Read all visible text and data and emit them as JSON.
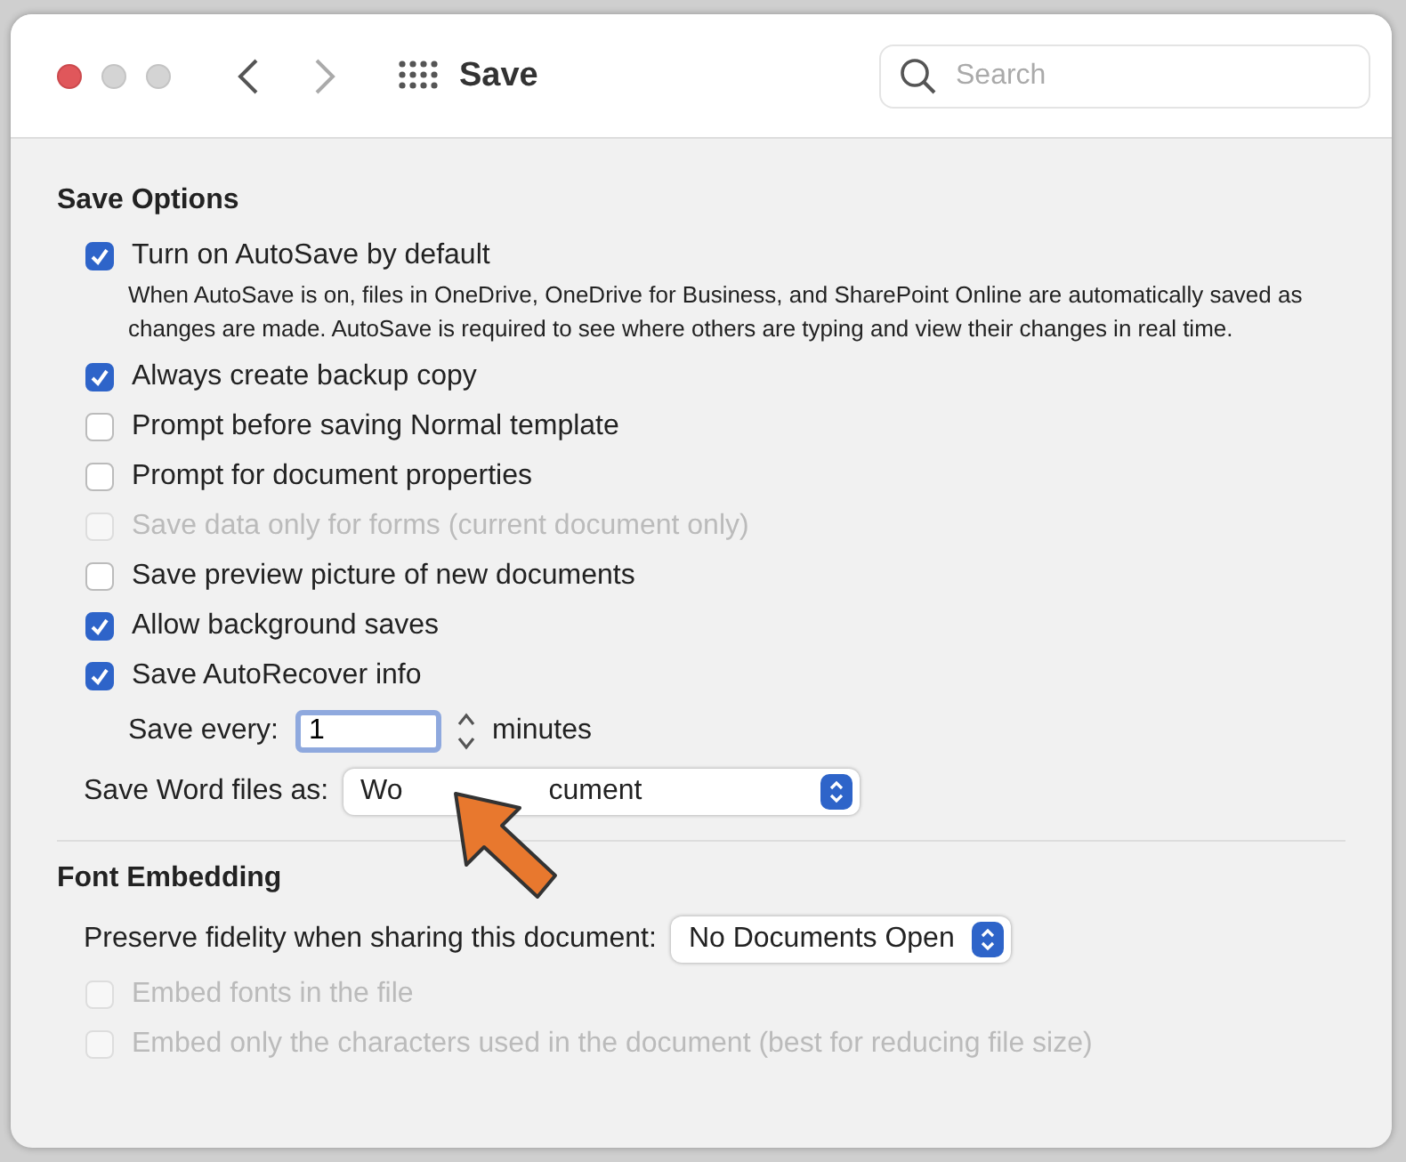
{
  "window": {
    "title": "Save",
    "search": {
      "placeholder": "Search"
    }
  },
  "sections": [
    {
      "title": "Save Options",
      "items": [
        {
          "kind": "checkbox",
          "label": "Turn on AutoSave by default",
          "checked": true,
          "disabled": false,
          "description": "When AutoSave is on, files in OneDrive, OneDrive for Business, and SharePoint Online are automatically saved as changes are made. AutoSave is required to see where others are typing and view their changes in real time."
        },
        {
          "kind": "checkbox",
          "label": "Always create backup copy",
          "checked": true,
          "disabled": false
        },
        {
          "kind": "checkbox",
          "label": "Prompt before saving Normal template",
          "checked": false,
          "disabled": false
        },
        {
          "kind": "checkbox",
          "label": "Prompt for document properties",
          "checked": false,
          "disabled": false
        },
        {
          "kind": "checkbox",
          "label": "Save data only for forms (current document only)",
          "checked": false,
          "disabled": true
        },
        {
          "kind": "checkbox",
          "label": "Save preview picture of new documents",
          "checked": false,
          "disabled": false
        },
        {
          "kind": "checkbox",
          "label": "Allow background saves",
          "checked": true,
          "disabled": false
        },
        {
          "kind": "checkbox",
          "label": "Save AutoRecover info",
          "checked": true,
          "disabled": false
        },
        {
          "kind": "stepper",
          "label": "Save every:",
          "value": "1",
          "unit": "minutes"
        },
        {
          "kind": "select",
          "label": "Save Word files as:",
          "value_parts": [
            "Wo",
            "cument"
          ]
        }
      ]
    },
    {
      "title": "Font Embedding",
      "items": [
        {
          "kind": "select",
          "label": "Preserve fidelity when sharing this document:",
          "value_parts": [
            "No Documents Open"
          ]
        },
        {
          "kind": "checkbox",
          "label": "Embed fonts in the file",
          "checked": false,
          "disabled": true
        },
        {
          "kind": "checkbox",
          "label": "Embed only the characters used in the document (best for reducing file size)",
          "checked": false,
          "disabled": true
        }
      ]
    }
  ]
}
